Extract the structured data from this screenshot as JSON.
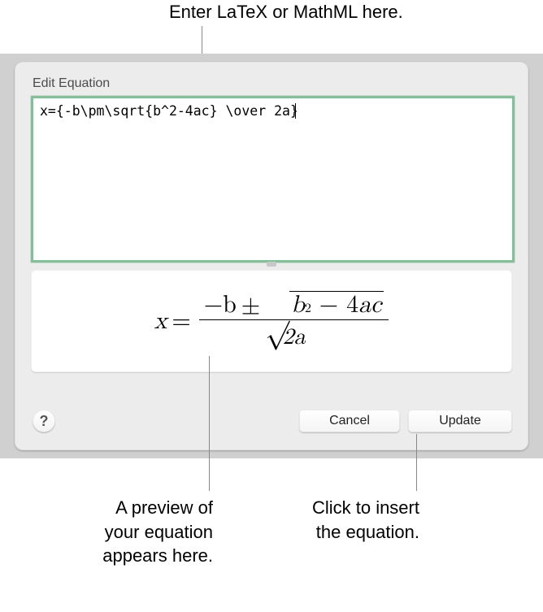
{
  "annotations": {
    "top": "Enter LaTeX or MathML here.",
    "left": "A preview of\nyour equation\nappears here.",
    "right": "Click to insert\nthe equation."
  },
  "dialog": {
    "title": "Edit Equation",
    "input_value": "x={-b\\pm\\sqrt{b^2-4ac} \\over 2a}",
    "help_label": "?",
    "cancel_label": "Cancel",
    "update_label": "Update"
  },
  "equation_preview": {
    "latex": "x = \\frac{-b \\pm \\sqrt{b^{2} - 4ac}}{2a}",
    "lhs_var": "x",
    "numerator_leading": "−b",
    "operator": "±",
    "radicand": "b² − 4ac",
    "denominator": "2a"
  }
}
